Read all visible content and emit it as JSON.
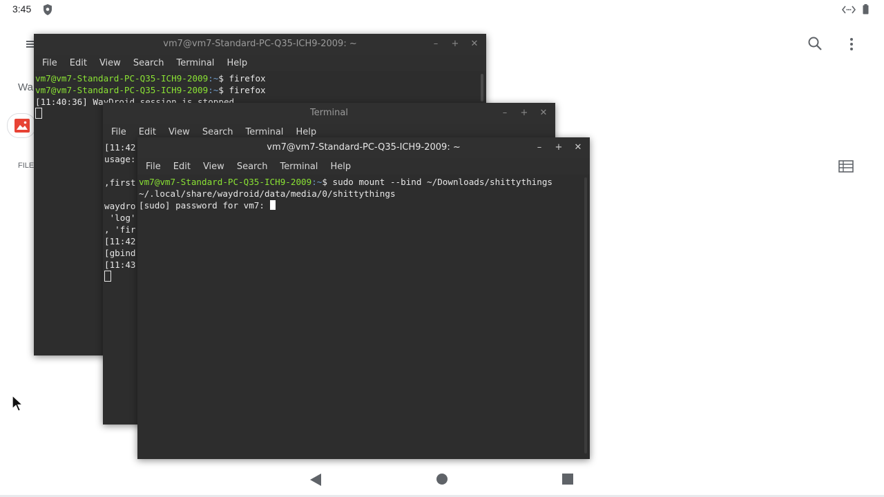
{
  "status_bar": {
    "time": "3:45"
  },
  "background_app": {
    "title_partial": "Wa",
    "files_label": "FILE"
  },
  "win1": {
    "title": "vm7@vm7-Standard-PC-Q35-ICH9-2009: ~",
    "menu": [
      "File",
      "Edit",
      "View",
      "Search",
      "Terminal",
      "Help"
    ],
    "lines": [
      {
        "user": "vm7@vm7-Standard-PC-Q35-ICH9-2009",
        "path": ":~",
        "cmd": "$ firefox"
      },
      {
        "user": "vm7@vm7-Standard-PC-Q35-ICH9-2009",
        "path": ":~",
        "cmd": "$ firefox"
      }
    ],
    "output": "[11:40:36] WayDroid session is stopped"
  },
  "win2": {
    "title": "Terminal",
    "menu": [
      "File",
      "Edit",
      "View",
      "Search",
      "Terminal",
      "Help"
    ],
    "lines": [
      "[11:42",
      "usage:",
      "",
      ",first",
      "",
      "waydro",
      " 'log'",
      ", 'fir",
      "[11:42",
      "[gbind",
      "[11:43"
    ]
  },
  "win3": {
    "title": "vm7@vm7-Standard-PC-Q35-ICH9-2009: ~",
    "menu": [
      "File",
      "Edit",
      "View",
      "Search",
      "Terminal",
      "Help"
    ],
    "prompt_user": "vm7@vm7-Standard-PC-Q35-ICH9-2009",
    "prompt_path": ":~",
    "command": "$ sudo mount --bind ~/Downloads/shittythings",
    "command_cont": "~/.local/share/waydroid/data/media/0/shittythings",
    "sudo_prompt": "[sudo] password for vm7: "
  },
  "colors": {
    "prompt_user": "#8ae234",
    "prompt_path": "#729fcf",
    "terminal_bg": "#2d2d2d"
  }
}
